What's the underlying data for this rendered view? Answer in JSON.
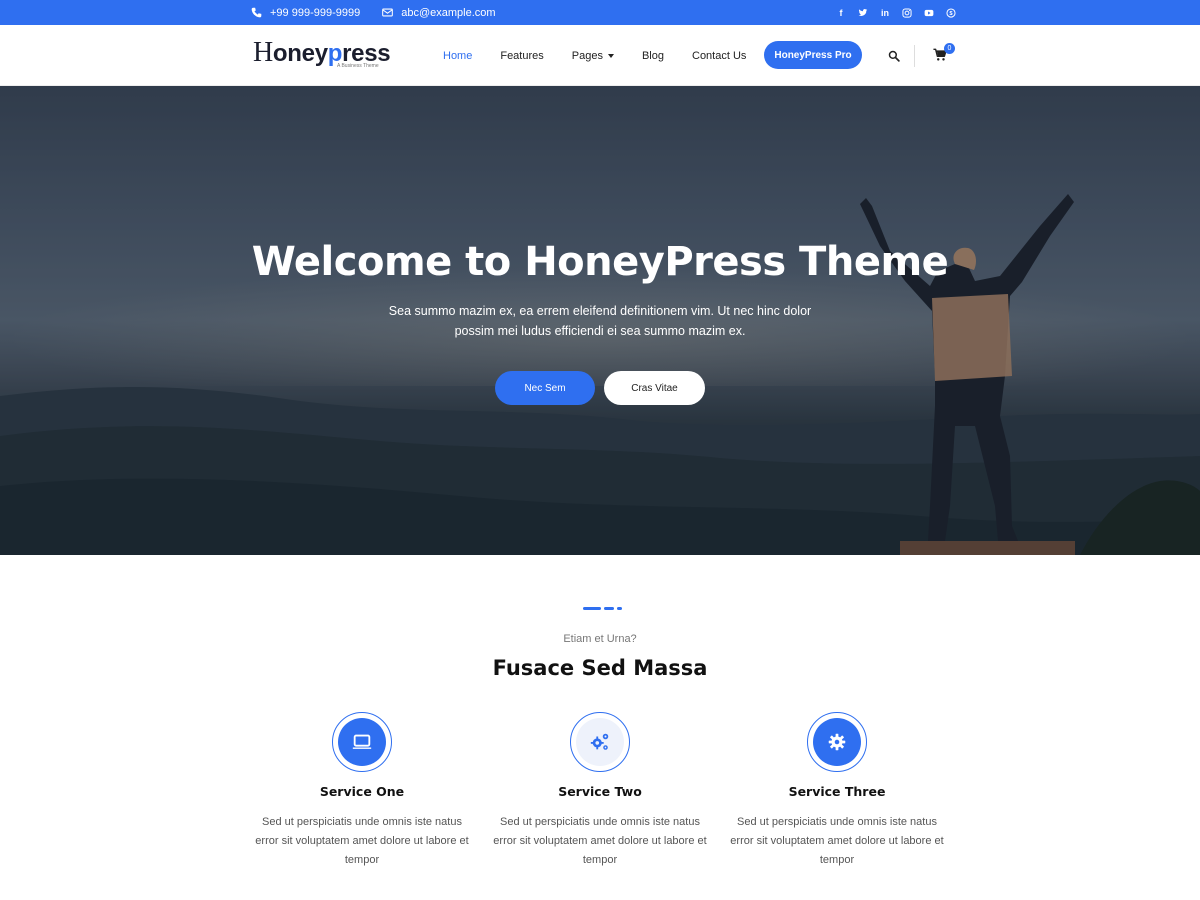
{
  "topbar": {
    "phone": "+99 999-999-9999",
    "email": "abc@example.com",
    "social_icons": [
      "facebook-icon",
      "twitter-icon",
      "linkedin-icon",
      "instagram-icon",
      "youtube-icon",
      "skype-icon"
    ],
    "background": "#2f6ff0"
  },
  "header": {
    "logo_text": "Honeypress",
    "logo_tagline": "A Business Theme",
    "nav": [
      {
        "label": "Home",
        "active": true
      },
      {
        "label": "Features",
        "active": false
      },
      {
        "label": "Pages",
        "active": false,
        "dropdown": true
      },
      {
        "label": "Blog",
        "active": false
      },
      {
        "label": "Contact Us",
        "active": false
      }
    ],
    "pro_button": "HoneyPress Pro",
    "cart_count": "0"
  },
  "hero": {
    "title": "Welcome to HoneyPress Theme",
    "subtitle": "Sea summo mazim ex, ea errem eleifend definitionem vim. Ut nec hinc dolor possim mei ludus efficiendi ei sea summo mazim ex.",
    "primary_button": "Nec Sem",
    "secondary_button": "Cras Vitae"
  },
  "services": {
    "eyebrow": "Etiam et Urna?",
    "title": "Fusace Sed Massa",
    "items": [
      {
        "icon": "laptop-icon",
        "title": "Service One",
        "text": "Sed ut perspiciatis unde omnis iste natus error sit voluptatem amet dolore ut labore et tempor"
      },
      {
        "icon": "gears-icon",
        "title": "Service Two",
        "text": "Sed ut perspiciatis unde omnis iste natus error sit voluptatem amet dolore ut labore et tempor"
      },
      {
        "icon": "gear-icon",
        "title": "Service Three",
        "text": "Sed ut perspiciatis unde omnis iste natus error sit voluptatem amet dolore ut labore et tempor"
      }
    ]
  },
  "colors": {
    "accent": "#2f6ff0",
    "text": "#111111",
    "muted": "#777777"
  }
}
